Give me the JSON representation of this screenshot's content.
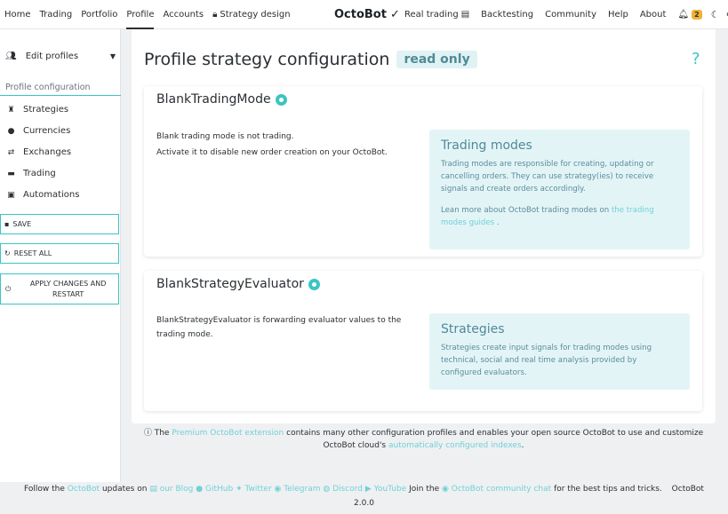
{
  "nav": {
    "left": [
      "Home",
      "Trading",
      "Portfolio",
      "Profile",
      "Accounts",
      "Strategy design"
    ],
    "brand": "OctoBot",
    "right": [
      "Real trading",
      "Backtesting",
      "Community",
      "Help",
      "About"
    ],
    "notification_count": "2"
  },
  "sidebar": {
    "edit_profiles": "Edit profiles",
    "section": "Profile configuration",
    "items": [
      "Strategies",
      "Currencies",
      "Exchanges",
      "Trading",
      "Automations"
    ],
    "save": "SAVE",
    "reset_all": "RESET ALL",
    "apply_line1": "APPLY CHANGES AND",
    "apply_line2": "RESTART"
  },
  "main": {
    "title": "Profile strategy configuration",
    "badge": "read only",
    "help_icon": "?",
    "panels": [
      {
        "title": "BlankTradingMode",
        "desc1": "Blank trading mode is not trading.",
        "desc2": "Activate it to disable new order creation on your OctoBot.",
        "info_title": "Trading modes",
        "info_p1_l1": "Trading modes are responsible for creating, updating or",
        "info_p1_l2": "cancelling orders. They can use strategy(ies) to receive",
        "info_p1_l3": "signals and create orders accordingly.",
        "info_p2_l1": "Lean more about OctoBot trading modes on",
        "info_p2_link1": "the trading",
        "info_p2_link2": "modes guides",
        "info_p2_end": "."
      },
      {
        "title": "BlankStrategyEvaluator",
        "desc1": "BlankStrategyEvaluator is forwarding evaluator values to the",
        "desc2": "trading mode.",
        "info_title": "Strategies",
        "info_p1_l1": "Strategies create input signals for trading modes using",
        "info_p1_l2": "technical, social and real time analysis provided by",
        "info_p1_l3": "configured evaluators."
      }
    ]
  },
  "note": {
    "pre": "The",
    "link1": "Premium OctoBot extension",
    "mid": "contains many other configuration profiles and enables your open source OctoBot to use and customize",
    "line2_pre": "OctoBot cloud's",
    "link2": "automatically configured indexes",
    "end": "."
  },
  "footer": {
    "follow": "Follow the",
    "octobot_link": "OctoBot",
    "updates_on": "updates on",
    "blog": "our Blog",
    "github": "GitHub",
    "twitter": "Twitter",
    "telegram": "Telegram",
    "discord": "Discord",
    "youtube": "YouTube",
    "join": "Join the",
    "chat": "OctoBot community chat",
    "tips": "for the best tips and tricks.",
    "brand": "OctoBot",
    "version": "2.0.0"
  },
  "colors": {
    "accent": "#3cc4c4",
    "info_bg": "#e3f4f7",
    "badge": "#f0b232"
  }
}
